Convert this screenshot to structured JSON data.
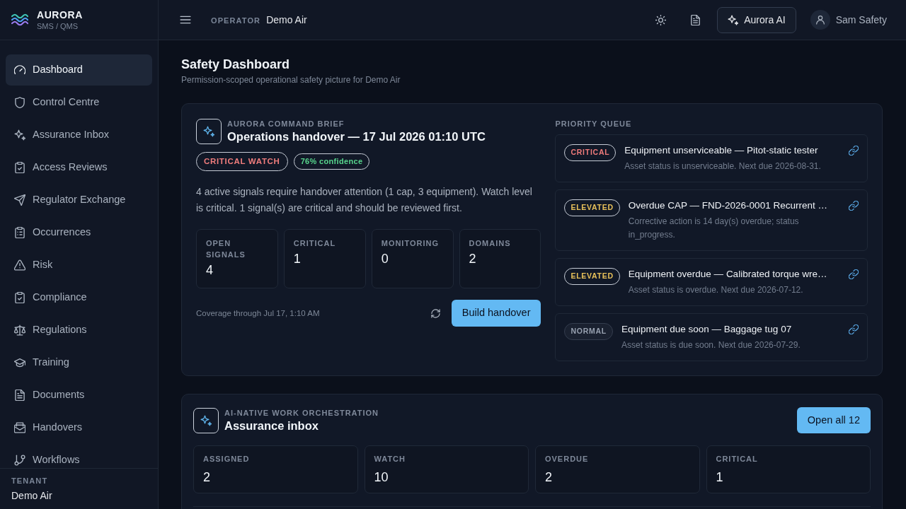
{
  "sidebar": {
    "brand": {
      "name": "AURORA",
      "tagline": "SMS / QMS"
    },
    "items": [
      {
        "label": "Dashboard",
        "selected": true
      },
      {
        "label": "Control Centre",
        "selected": false
      },
      {
        "label": "Assurance Inbox",
        "selected": false
      },
      {
        "label": "Access Reviews",
        "selected": false
      },
      {
        "label": "Regulator Exchange",
        "selected": false
      },
      {
        "label": "Occurrences",
        "selected": false
      },
      {
        "label": "Risk",
        "selected": false
      },
      {
        "label": "Compliance",
        "selected": false
      },
      {
        "label": "Regulations",
        "selected": false
      },
      {
        "label": "Training",
        "selected": false
      },
      {
        "label": "Documents",
        "selected": false
      },
      {
        "label": "Handovers",
        "selected": false
      },
      {
        "label": "Workflows",
        "selected": false
      }
    ],
    "tenant": {
      "label": "TENANT",
      "value": "Demo Air"
    }
  },
  "topbar": {
    "operator_label": "OPERATOR",
    "operator": "Demo Air",
    "ai_button": "Aurora AI",
    "user": "Sam Safety"
  },
  "page": {
    "title": "Safety Dashboard",
    "subtitle": "Permission-scoped operational safety picture for Demo Air"
  },
  "command_brief": {
    "eyebrow": "AURORA COMMAND BRIEF",
    "title": "Operations handover — 17 Jul 2026 01:10 UTC",
    "badges": [
      {
        "text": "CRITICAL WATCH",
        "color": "#f07d7d"
      },
      {
        "text": "76% confidence",
        "color": "#58d68d"
      }
    ],
    "summary": "4 active signals require handover attention (1 cap, 3 equipment). Watch level is critical. 1 signal(s) are critical and should be reviewed first.",
    "stats": [
      {
        "label": "OPEN SIGNALS",
        "value": "4"
      },
      {
        "label": "CRITICAL",
        "value": "1"
      },
      {
        "label": "MONITORING",
        "value": "0"
      },
      {
        "label": "DOMAINS",
        "value": "2"
      }
    ],
    "coverage": "Coverage through Jul 17, 1:10 AM",
    "button": "Build handover"
  },
  "priority_queue": {
    "title": "PRIORITY QUEUE",
    "items": [
      {
        "badge": {
          "text": "CRITICAL",
          "color": "#ef7b7b",
          "kind": "outline"
        },
        "title": "Equipment unserviceable — Pitot-static tester",
        "detail": "Asset status is unserviceable. Next due 2026-08-31."
      },
      {
        "badge": {
          "text": "ELEVATED",
          "color": "#e8c15a",
          "kind": "outline"
        },
        "title": "Overdue CAP — FND-2026-0001 Recurrent …",
        "detail": "Corrective action is 14 day(s) overdue; status in_progress."
      },
      {
        "badge": {
          "text": "ELEVATED",
          "color": "#e8c15a",
          "kind": "outline"
        },
        "title": "Equipment overdue — Calibrated torque wre…",
        "detail": "Asset status is overdue. Next due 2026-07-12."
      },
      {
        "badge": {
          "text": "NORMAL",
          "color": "#98a1b0",
          "kind": "soft"
        },
        "title": "Equipment due soon — Baggage tug 07",
        "detail": "Asset status is due soon. Next due 2026-07-29."
      }
    ]
  },
  "assurance_inbox": {
    "eyebrow": "AI-NATIVE WORK ORCHESTRATION",
    "title": "Assurance inbox",
    "button": "Open all 12",
    "stats": [
      {
        "label": "ASSIGNED",
        "value": "2"
      },
      {
        "label": "WATCH",
        "value": "10"
      },
      {
        "label": "OVERDUE",
        "value": "2"
      },
      {
        "label": "CRITICAL",
        "value": "1"
      }
    ]
  }
}
